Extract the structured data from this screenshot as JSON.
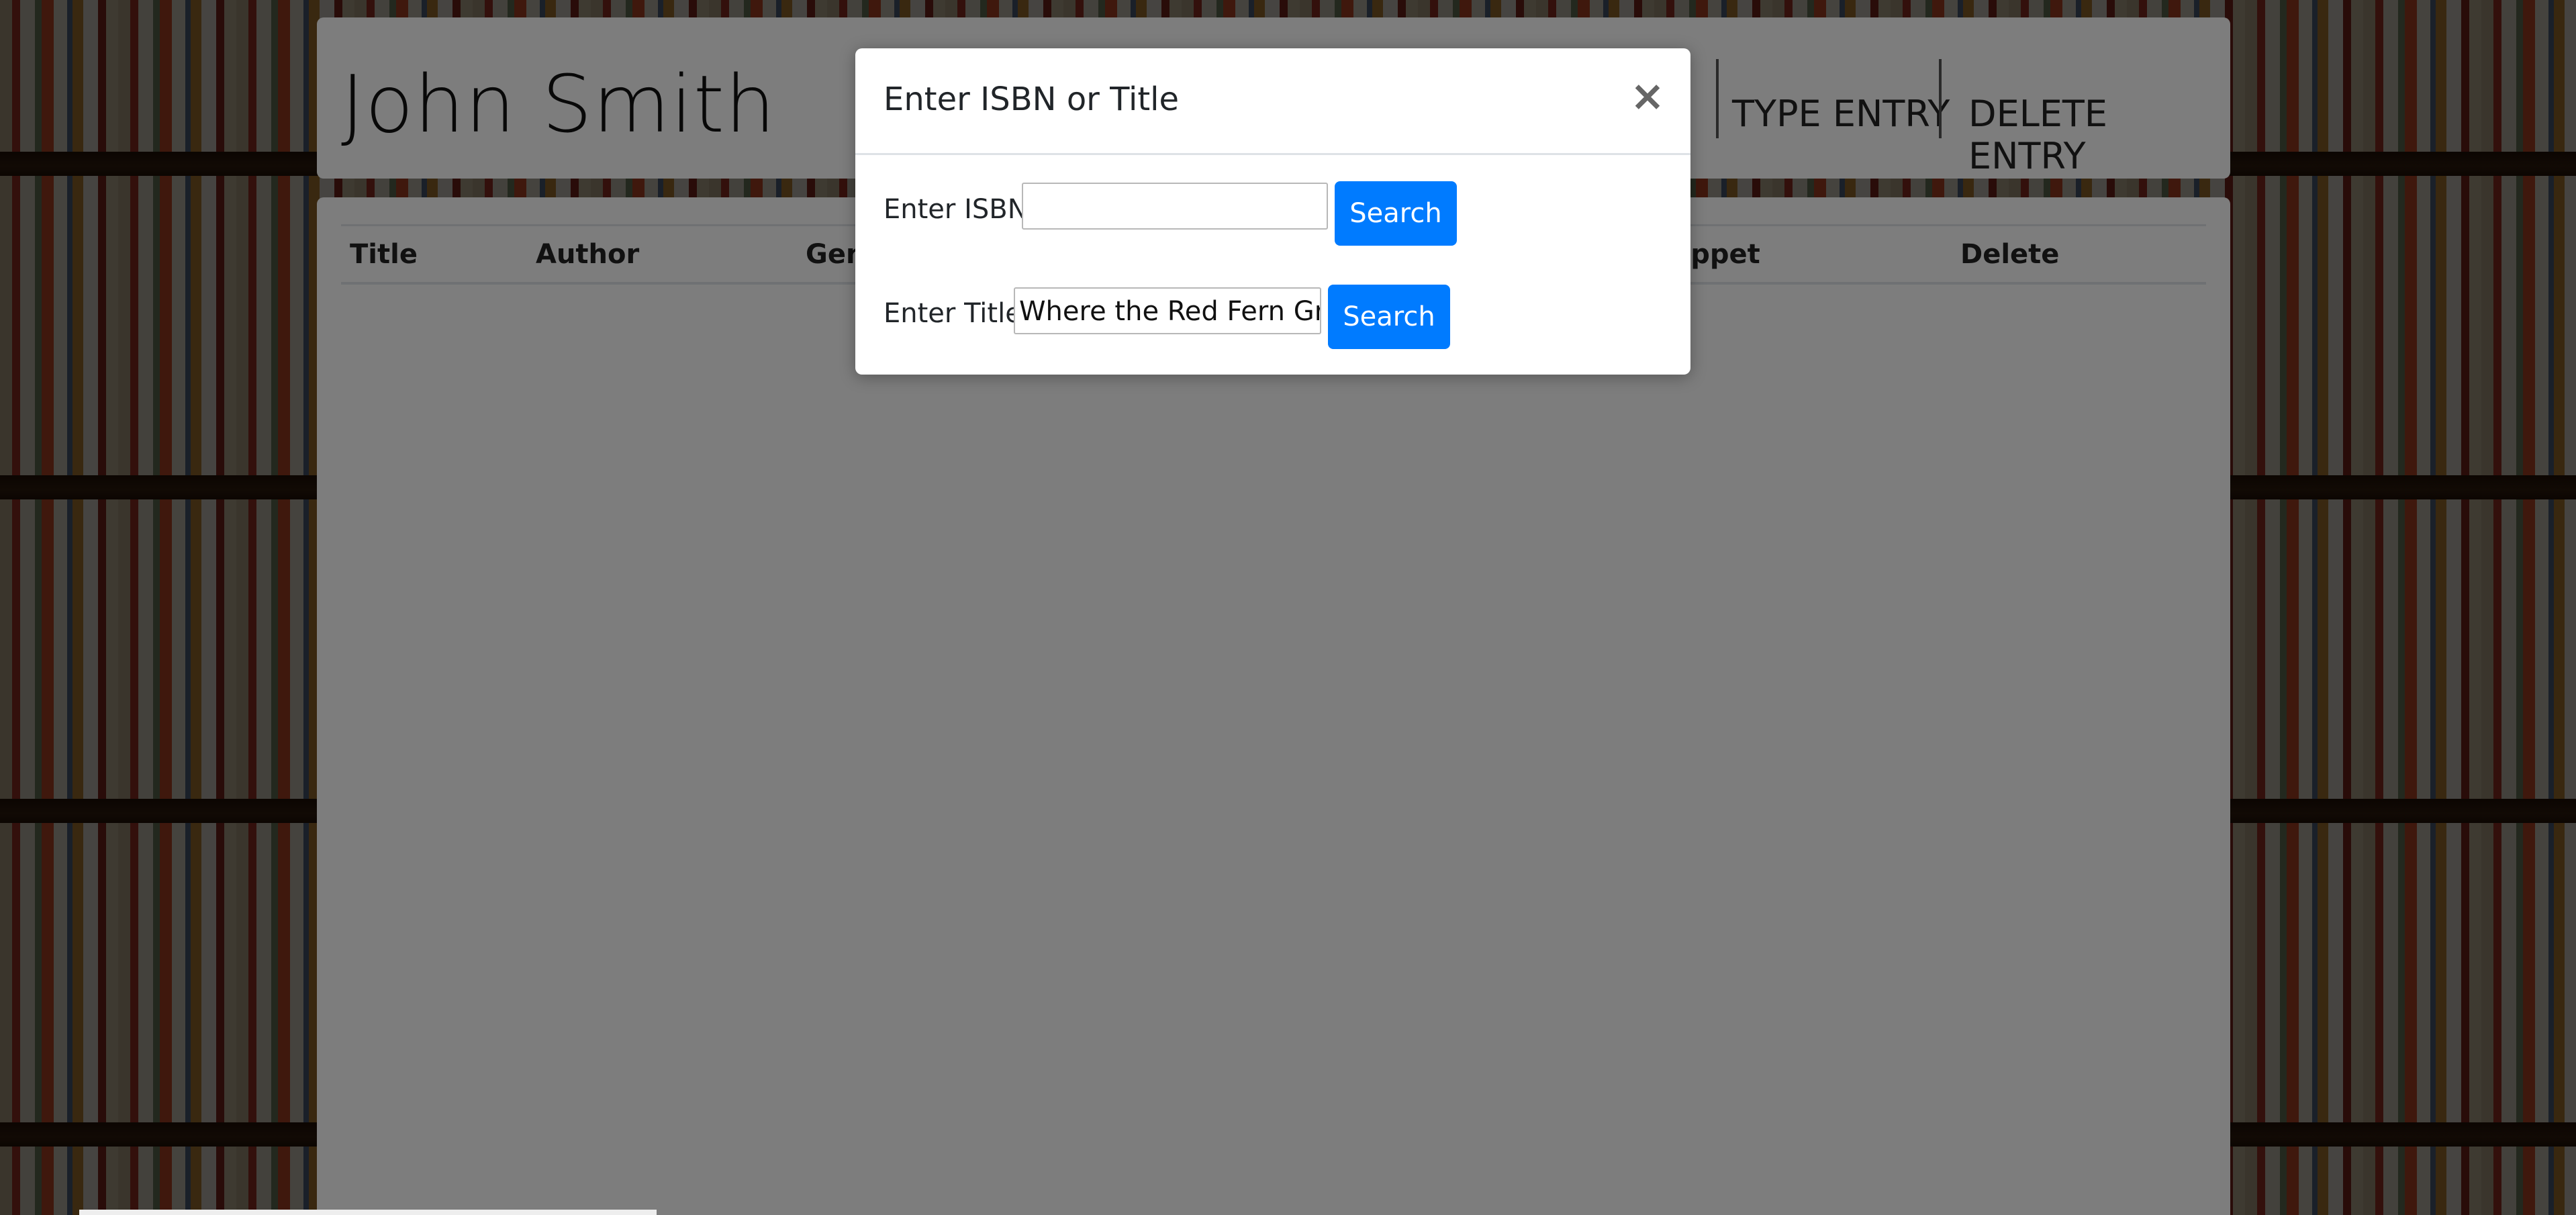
{
  "header": {
    "user_name": "John Smith",
    "nav": [
      "TYPE ENTRY",
      "DELETE ENTRY"
    ]
  },
  "table": {
    "headers": [
      "Title",
      "Author",
      "Gen",
      "nippet",
      "Delete"
    ]
  },
  "modal": {
    "title": "Enter ISBN or Title",
    "close_symbol": "×",
    "isbn_label": "Enter ISBN:",
    "isbn_value": "",
    "title_label": "Enter Title:",
    "title_value": "Where the Red Fern Grow",
    "search_label": "Search"
  },
  "colors": {
    "primary": "#007bff",
    "card": "#fafafa"
  }
}
